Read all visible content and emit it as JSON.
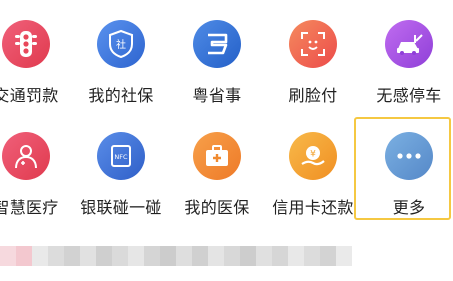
{
  "row1": [
    {
      "label": "交通罚款",
      "icon": "traffic-light-icon",
      "color": "#e8475a"
    },
    {
      "label": "我的社保",
      "icon": "social-security-shield-icon",
      "color": "#3d78e0"
    },
    {
      "label": "粤省事",
      "icon": "yue-app-icon",
      "color": "#3475d9"
    },
    {
      "label": "刷脸付",
      "icon": "face-pay-icon",
      "color": "#f06a4a"
    },
    {
      "label": "无感停车",
      "icon": "parking-car-icon",
      "color": "#a04fe0"
    }
  ],
  "row2": [
    {
      "label": "智慧医疗",
      "icon": "doctor-icon",
      "color": "#e8475a"
    },
    {
      "label": "银联碰一碰",
      "icon": "nfc-card-icon",
      "color": "#3a6fd6"
    },
    {
      "label": "我的医保",
      "icon": "medical-kit-icon",
      "color": "#f08a30"
    },
    {
      "label": "信用卡还款",
      "icon": "credit-repay-icon",
      "color": "#f2a02a"
    },
    {
      "label": "更多",
      "icon": "more-dots-icon",
      "color": "#6d9fd6"
    }
  ],
  "colors": {
    "highlight_border": "#f5c842",
    "text": "#222222"
  }
}
